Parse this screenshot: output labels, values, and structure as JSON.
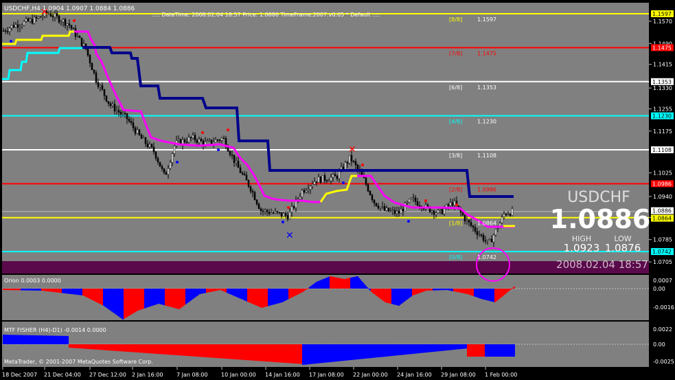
{
  "main_panel": {
    "symbol_info": "USDCHF,H4  1.0904 1.0907 1.0884 1.0886",
    "info_line": ":::: DateTime: 2008.02.04 18:57    Price: 1.0886    TimeFrame:2007.v0.05    *  Default  ::::",
    "big_symbol": "USDCHF",
    "big_price": "1.0886",
    "high_label": "HIGH",
    "low_label": "LOW",
    "high_value": "1.0923",
    "low_value": "1.0876",
    "datetime": "2008.02.04 18:57",
    "levels": [
      {
        "label": "[8/8]",
        "value": "1.1597",
        "color": "#ffff00",
        "price": 1.1597,
        "width": 2,
        "show_label": true
      },
      {
        "label": "[7/8]",
        "value": "1.1475",
        "color": "#ff0000",
        "price": 1.1475,
        "width": 2,
        "show_label": true
      },
      {
        "label": "[6/8]",
        "value": "1.1353",
        "color": "#ffffff",
        "price": 1.1353,
        "width": 2,
        "show_label": true
      },
      {
        "label": "[4/8]",
        "value": "1.1230",
        "color": "#00ffff",
        "price": 1.123,
        "width": 2,
        "show_label": true
      },
      {
        "label": "[3/8]",
        "value": "1.1108",
        "color": "#ffffff",
        "price": 1.1108,
        "width": 2,
        "show_label": true
      },
      {
        "label": "[2/8]",
        "value": "1.0986",
        "color": "#ff0000",
        "price": 1.0986,
        "width": 2,
        "show_label": true
      },
      {
        "label": "[1/8]",
        "value": "1.0864",
        "color": "#ffff00",
        "price": 1.0864,
        "width": 2,
        "show_label": true
      },
      {
        "label": "[0/8]",
        "value": "1.0742",
        "color": "#00ffff",
        "price": 1.0742,
        "width": 2,
        "show_label": true
      },
      {
        "label": "",
        "value": "1.0886",
        "color": "#c0c0c0",
        "price": 1.0886,
        "width": 1,
        "show_label": false
      }
    ],
    "axis_labels": [
      "1.1570",
      "1.1490",
      "1.1415",
      "1.1330",
      "1.1255",
      "1.1175",
      "1.1025",
      "1.0940",
      "1.0865",
      "1.0785",
      "1.0705"
    ],
    "axis_label_prices": [
      1.157,
      1.149,
      1.1415,
      1.133,
      1.1255,
      1.1175,
      1.1025,
      1.094,
      1.0865,
      1.0785,
      1.0705
    ],
    "axis_tags": [
      {
        "text": "1.1597",
        "bg": "#ffff00",
        "fg": "#000000",
        "price": 1.1597
      },
      {
        "text": "1.1475",
        "bg": "#ff0000",
        "fg": "#ffffff",
        "price": 1.1475
      },
      {
        "text": "1.1353",
        "bg": "#ffffff",
        "fg": "#000000",
        "price": 1.1353
      },
      {
        "text": "1.1230",
        "bg": "#00ffff",
        "fg": "#000000",
        "price": 1.123
      },
      {
        "text": "1.1108",
        "bg": "#ffffff",
        "fg": "#000000",
        "price": 1.1108
      },
      {
        "text": "1.0986",
        "bg": "#ff0000",
        "fg": "#ffffff",
        "price": 1.0986
      },
      {
        "text": "1.0886",
        "bg": "#ffffff",
        "fg": "#000000",
        "price": 1.0889
      },
      {
        "text": "1.0864",
        "bg": "#ffff00",
        "fg": "#000000",
        "price": 1.0862
      },
      {
        "text": "1.0742",
        "bg": "#00ffff",
        "fg": "#000000",
        "price": 1.0742
      }
    ]
  },
  "osc1": {
    "title": "Orion 0.0003 0.0000",
    "axis_labels": [
      "0.0007",
      "0.00",
      "-0.0016"
    ],
    "axis_values": [
      0.0007,
      0.0,
      -0.0016
    ]
  },
  "osc2": {
    "title": "MTF FISHER (H4)-D1) -0.0014 0.0000",
    "copyright": "MetaTrader, © 2001-2007 MetaQuotes Software Corp.",
    "axis_labels": [
      "0.0022",
      "0.00",
      "-0.0025"
    ],
    "axis_values": [
      0.0022,
      0.0,
      -0.0025
    ]
  },
  "time_axis": [
    "18 Dec 2007",
    "21 Dec 04:00",
    "27 Dec 12:00",
    "2 Jan 16:00",
    "7 Jan 08:00",
    "10 Jan 00:00",
    "14 Jan 16:00",
    "17 Jan 08:00",
    "22 Jan 00:00",
    "24 Jan 16:00",
    "29 Jan 08:00",
    "1 Feb 00:00"
  ],
  "colors": {
    "background": "#808080",
    "bull": "#0000ff",
    "bear": "#ff0000",
    "ma_navy": "#00008b",
    "ma_magenta": "#ff00ff",
    "ma_yellow": "#ffff00",
    "ma_cyan": "#00ffff",
    "dark_band": "#5a0a4a"
  }
}
